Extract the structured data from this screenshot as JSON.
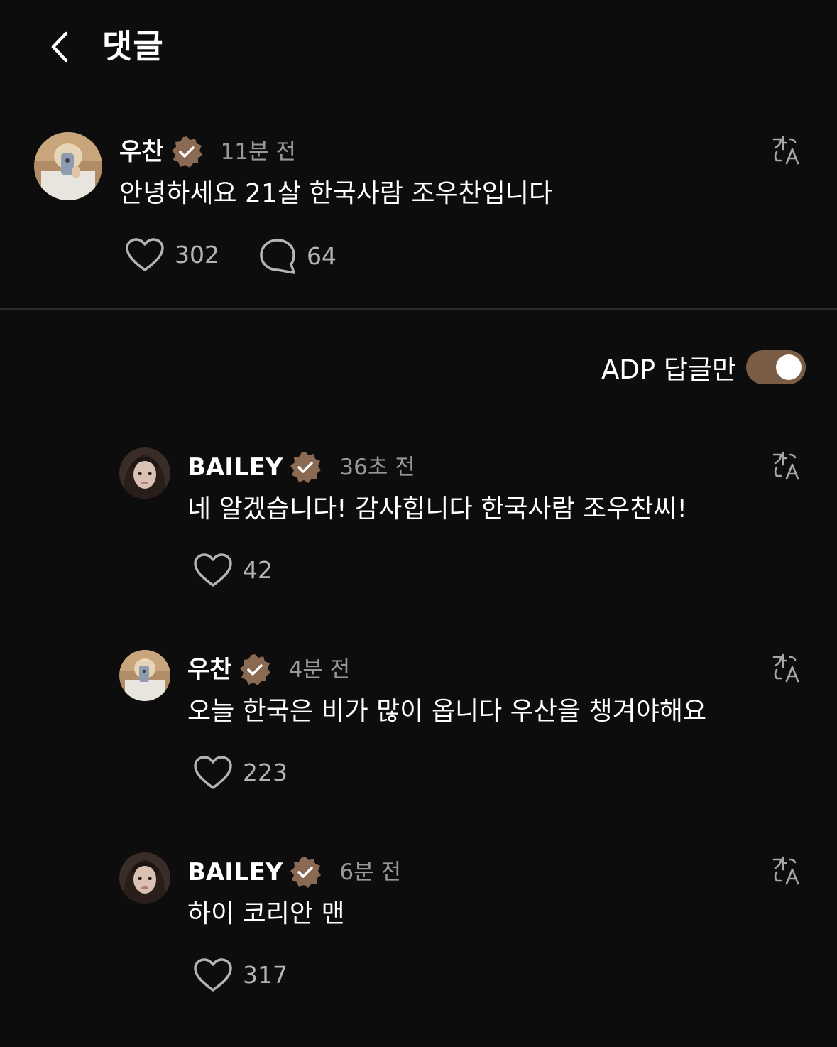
{
  "header": {
    "title": "댓글"
  },
  "main_comment": {
    "username": "우찬",
    "timestamp": "11분 전",
    "text": "안녕하세요 21살 한국사람 조우찬입니다",
    "likes": "302",
    "replies": "64"
  },
  "filter": {
    "label": "ADP 답글만",
    "enabled": true
  },
  "replies": [
    {
      "username": "BAILEY",
      "timestamp": "36초 전",
      "text": "네 알겠습니다! 감사힙니다 한국사람 조우찬씨!",
      "likes": "42"
    },
    {
      "username": "우찬",
      "timestamp": "4분 전",
      "text": "오늘 한국은 비가 많이 옵니다 우산을 챙겨야해요",
      "likes": "223"
    },
    {
      "username": "BAILEY",
      "timestamp": "6분 전",
      "text": "하이 코리안 맨",
      "likes": "317"
    }
  ],
  "colors": {
    "background": "#0e0d0d",
    "accent": "#7b5c45",
    "verified_badge": "#8a6a52",
    "muted_text": "#9a9896"
  },
  "icons": {
    "back": "chevron-left-icon",
    "verified": "verified-badge-icon",
    "translate": "translate-icon",
    "like": "heart-icon",
    "reply": "speech-bubble-icon"
  }
}
